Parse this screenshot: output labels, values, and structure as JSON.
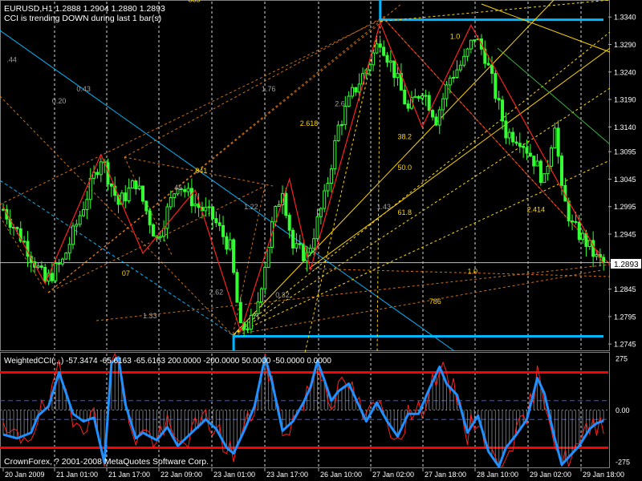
{
  "header": {
    "symbol_info": "EURUSD,H1  1.2888 1.2904 1.2880 1.2893",
    "trend_message": "CCI is trending DOWN during last 1 bar(s)"
  },
  "indicator_header": "WeightedCCI(,,,) -57.3474 -65.6163 -65.6163 200.0000 -200.0000 50.0000 -50.0000 0.0000",
  "copyright": "CrownForex, ? 2001-2008 MetaQuotes Software Corp.",
  "current_price_label": "1.2893",
  "colors": {
    "background": "#000000",
    "candle": "#33ff33",
    "grid": "#ffffff",
    "fib_gold": "#ffd700",
    "fib_orange": "#ff8c1a",
    "zigzag": "#ff2020",
    "channel": "#00b7ff",
    "cci_line": "#1e90ff",
    "cci_thin": "#ff2020",
    "cci_levels": "#ff0000",
    "cci_dashed": "#3355ff"
  },
  "fib_labels": [
    {
      "text": "885",
      "price": 1.3367,
      "bar": 53,
      "color": "gold"
    },
    {
      "text": "1.0",
      "price": 1.33,
      "bar": 128,
      "color": "gold"
    },
    {
      "text": ".44",
      "price": 1.3258,
      "bar": 1,
      "color": "gray"
    },
    {
      "text": "0.43",
      "price": 1.3205,
      "bar": 21,
      "color": "gray"
    },
    {
      "text": "0.20",
      "price": 1.3183,
      "bar": 14,
      "color": "gray"
    },
    {
      "text": "1.76",
      "price": 1.3205,
      "bar": 74,
      "color": "gray"
    },
    {
      "text": "2.6",
      "price": 1.3178,
      "bar": 95,
      "color": "gray"
    },
    {
      "text": "2.618",
      "price": 1.3142,
      "bar": 85,
      "color": "gold"
    },
    {
      "text": "38.2",
      "price": 1.3118,
      "bar": 113,
      "color": "gold"
    },
    {
      "text": "841",
      "price": 1.3056,
      "bar": 55,
      "color": "gold"
    },
    {
      "text": "45",
      "price": 1.3025,
      "bar": 49,
      "color": "gray"
    },
    {
      "text": "50.0",
      "price": 1.3062,
      "bar": 113,
      "color": "gold"
    },
    {
      "text": "1.22",
      "price": 1.299,
      "bar": 69,
      "color": "gray"
    },
    {
      "text": "1.43",
      "price": 1.299,
      "bar": 107,
      "color": "gray"
    },
    {
      "text": "61.8",
      "price": 1.298,
      "bar": 113,
      "color": "gold"
    },
    {
      "text": "2.414",
      "price": 1.2985,
      "bar": 150,
      "color": "gold"
    },
    {
      "text": "07",
      "price": 1.2869,
      "bar": 34,
      "color": "gold"
    },
    {
      "text": "1.0",
      "price": 1.2873,
      "bar": 133,
      "color": "gold"
    },
    {
      "text": "2.62",
      "price": 1.2835,
      "bar": 59,
      "color": "gray"
    },
    {
      "text": "0.32",
      "price": 1.283,
      "bar": 78,
      "color": "gray"
    },
    {
      "text": "786",
      "price": 1.2818,
      "bar": 122,
      "color": "gold"
    },
    {
      "text": "1.33",
      "price": 1.2792,
      "bar": 40,
      "color": "gray"
    }
  ],
  "chart_data": [
    {
      "type": "candlestick",
      "title": "EURUSD,H1",
      "ylim": [
        1.2735,
        1.3368
      ],
      "y_ticks": [
        "1.3340",
        "1.3290",
        "1.3240",
        "1.3190",
        "1.3140",
        "1.3095",
        "1.3045",
        "1.2995",
        "1.2945",
        "1.2893",
        "1.2845",
        "1.2795",
        "1.2745"
      ],
      "x_ticks": [
        "20 Jan 2009",
        "21 Jan 01:00",
        "21 Jan 17:00",
        "22 Jan 09:00",
        "23 Jan 01:00",
        "23 Jan 17:00",
        "26 Jan 10:00",
        "27 Jan 02:00",
        "27 Jan 18:00",
        "28 Jan 10:00",
        "29 Jan 02:00",
        "29 Jan 18:00"
      ],
      "price_anchors": [
        [
          0,
          1.299
        ],
        [
          6,
          1.293
        ],
        [
          12,
          1.2858
        ],
        [
          17,
          1.2895
        ],
        [
          22,
          1.298
        ],
        [
          28,
          1.3085
        ],
        [
          33,
          1.3
        ],
        [
          38,
          1.304
        ],
        [
          44,
          1.2935
        ],
        [
          50,
          1.304
        ],
        [
          55,
          1.3
        ],
        [
          60,
          1.2975
        ],
        [
          65,
          1.292
        ],
        [
          68,
          1.277
        ],
        [
          72,
          1.279
        ],
        [
          77,
          1.296
        ],
        [
          80,
          1.303
        ],
        [
          83,
          1.292
        ],
        [
          87,
          1.2905
        ],
        [
          92,
          1.301
        ],
        [
          96,
          1.314
        ],
        [
          100,
          1.32
        ],
        [
          104,
          1.3245
        ],
        [
          108,
          1.33
        ],
        [
          112,
          1.324
        ],
        [
          116,
          1.317
        ],
        [
          120,
          1.321
        ],
        [
          124,
          1.3155
        ],
        [
          128,
          1.323
        ],
        [
          132,
          1.326
        ],
        [
          135,
          1.3305
        ],
        [
          138,
          1.327
        ],
        [
          141,
          1.32
        ],
        [
          144,
          1.313
        ],
        [
          148,
          1.312
        ],
        [
          152,
          1.308
        ],
        [
          155,
          1.304
        ],
        [
          158,
          1.315
        ],
        [
          160,
          1.302
        ],
        [
          163,
          1.296
        ],
        [
          167,
          1.293
        ],
        [
          170,
          1.29
        ],
        [
          172,
          1.2893
        ]
      ],
      "zigzag": [
        [
          0,
          1.2995
        ],
        [
          12,
          1.2855
        ],
        [
          28,
          1.309
        ],
        [
          40,
          1.291
        ],
        [
          55,
          1.3025
        ],
        [
          68,
          1.2768
        ],
        [
          82,
          1.3045
        ],
        [
          88,
          1.288
        ],
        [
          108,
          1.333
        ],
        [
          120,
          1.314
        ],
        [
          134,
          1.3325
        ],
        [
          172,
          1.289
        ]
      ],
      "swing_high": 1.3332,
      "swing_low": 1.2762,
      "current_price": 1.2893
    },
    {
      "type": "line",
      "title": "WeightedCCI",
      "ylim": [
        -300,
        300
      ],
      "y_ticks": [
        "275",
        "0.00",
        "-275"
      ],
      "levels": [
        200,
        -200,
        50,
        -50,
        0
      ],
      "cci_main": [
        [
          0,
          -130
        ],
        [
          4,
          -150
        ],
        [
          8,
          -120
        ],
        [
          10,
          -30
        ],
        [
          13,
          20
        ],
        [
          16,
          200
        ],
        [
          18,
          90
        ],
        [
          20,
          -20
        ],
        [
          23,
          -60
        ],
        [
          26,
          -40
        ],
        [
          29,
          -280
        ],
        [
          31,
          250
        ],
        [
          33,
          280
        ],
        [
          35,
          30
        ],
        [
          38,
          -150
        ],
        [
          40,
          -120
        ],
        [
          44,
          -160
        ],
        [
          47,
          -90
        ],
        [
          50,
          -190
        ],
        [
          54,
          -120
        ],
        [
          58,
          -50
        ],
        [
          61,
          -100
        ],
        [
          64,
          -200
        ],
        [
          66,
          -230
        ],
        [
          69,
          -110
        ],
        [
          72,
          20
        ],
        [
          75,
          280
        ],
        [
          77,
          150
        ],
        [
          80,
          -110
        ],
        [
          83,
          -60
        ],
        [
          86,
          40
        ],
        [
          88,
          120
        ],
        [
          90,
          260
        ],
        [
          92,
          160
        ],
        [
          94,
          50
        ],
        [
          96,
          100
        ],
        [
          99,
          140
        ],
        [
          101,
          60
        ],
        [
          104,
          -60
        ],
        [
          107,
          40
        ],
        [
          110,
          -60
        ],
        [
          113,
          -140
        ],
        [
          116,
          -20
        ],
        [
          119,
          -20
        ],
        [
          122,
          110
        ],
        [
          125,
          230
        ],
        [
          127,
          140
        ],
        [
          130,
          80
        ],
        [
          133,
          -120
        ],
        [
          136,
          -30
        ],
        [
          139,
          -220
        ],
        [
          142,
          -300
        ],
        [
          144,
          -200
        ],
        [
          147,
          -130
        ],
        [
          150,
          -50
        ],
        [
          153,
          170
        ],
        [
          155,
          90
        ],
        [
          158,
          -150
        ],
        [
          160,
          -290
        ],
        [
          162,
          -250
        ],
        [
          165,
          -190
        ],
        [
          168,
          -100
        ],
        [
          170,
          -70
        ],
        [
          172,
          -57
        ]
      ],
      "current_value": -57.3474
    }
  ]
}
